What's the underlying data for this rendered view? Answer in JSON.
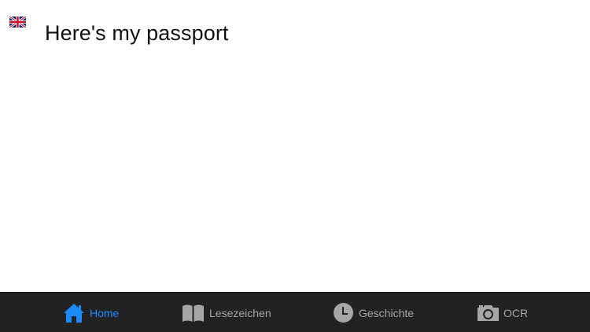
{
  "phrase": {
    "language_flag": "uk-flag-icon",
    "text": "Here's my passport"
  },
  "tabbar": {
    "active_color": "#1a8cff",
    "inactive_color": "#a6a6a6",
    "background": "#222222",
    "items": [
      {
        "label": "Home",
        "icon": "home-icon",
        "active": true
      },
      {
        "label": "Lesezeichen",
        "icon": "book-icon",
        "active": false
      },
      {
        "label": "Geschichte",
        "icon": "clock-icon",
        "active": false
      },
      {
        "label": "OCR",
        "icon": "camera-icon",
        "active": false
      }
    ]
  }
}
